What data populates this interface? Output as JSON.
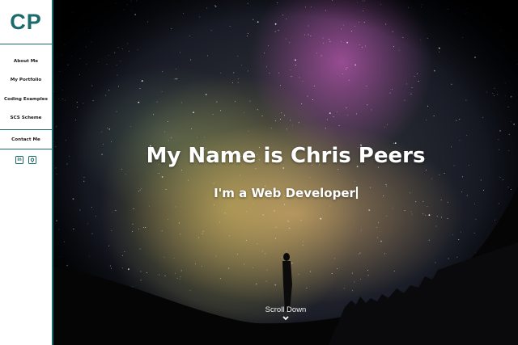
{
  "sidebar": {
    "logo": "CP",
    "nav": [
      {
        "label": "About Me"
      },
      {
        "label": "My Portfolio"
      },
      {
        "label": "Coding Examples"
      },
      {
        "label": "SCS Scheme"
      }
    ],
    "contact": {
      "label": "Contact Me"
    },
    "socials": [
      {
        "icon": "linkedin-icon",
        "glyph": "in"
      },
      {
        "icon": "github-icon",
        "glyph": "◖"
      }
    ]
  },
  "hero": {
    "title": "My Name is Chris Peers",
    "subtitle": "I'm a Web Developer",
    "scroll_label": "Scroll Down"
  },
  "colors": {
    "accent": "#1a6b6a",
    "text_dark": "#1a1a1a",
    "hero_text": "#ffffff"
  }
}
